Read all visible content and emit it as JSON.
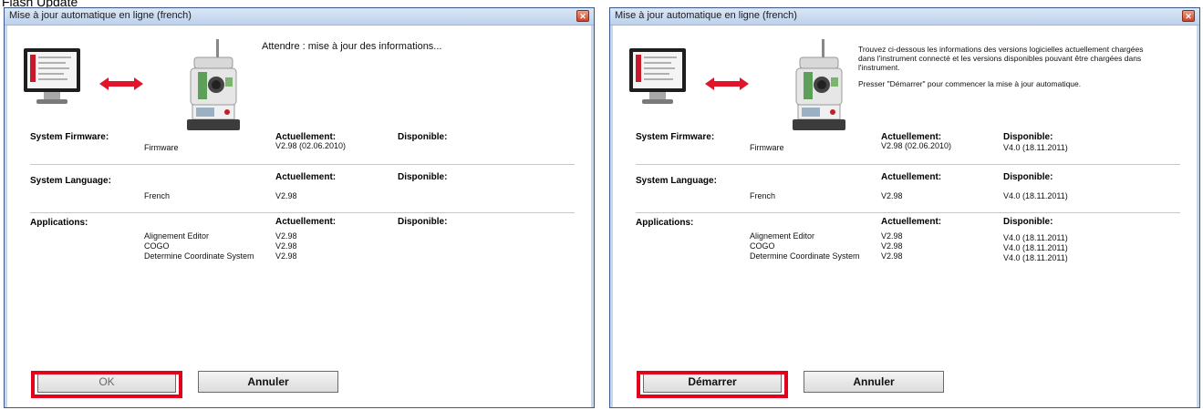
{
  "caption": "Flash Update",
  "windows": [
    {
      "title": "Mise à jour automatique en ligne (french)",
      "status": "Attendre : mise à jour des informations...",
      "info": [],
      "firmware": {
        "label": "System Firmware:",
        "current_head": "Actuellement:",
        "avail_head": "Disponible:",
        "items": [
          {
            "name": "Firmware",
            "current": "V2.98 (02.06.2010)",
            "avail": ""
          }
        ]
      },
      "language": {
        "label": "System Language:",
        "current_head": "Actuellement:",
        "avail_head": "Disponible:",
        "items": [
          {
            "name": "French",
            "current": "V2.98",
            "avail": ""
          }
        ]
      },
      "applications": {
        "label": "Applications:",
        "current_head": "Actuellement:",
        "avail_head": "Disponible:",
        "items": [
          {
            "name": "Alignement Editor",
            "current": "V2.98",
            "avail": ""
          },
          {
            "name": "COGO",
            "current": "V2.98",
            "avail": ""
          },
          {
            "name": "Determine Coordinate System",
            "current": "V2.98",
            "avail": ""
          }
        ]
      },
      "primary_button": "OK",
      "secondary_button": "Annuler",
      "primary_disabled": true
    },
    {
      "title": "Mise à jour automatique en ligne (french)",
      "status": "",
      "info": [
        "Trouvez ci-dessous les informations des versions logicielles actuellement chargées dans l'instrument connecté et les versions disponibles pouvant être chargées dans l'instrument.",
        "Presser \"Démarrer\" pour commencer la mise à jour automatique."
      ],
      "firmware": {
        "label": "System Firmware:",
        "current_head": "Actuellement:",
        "avail_head": "Disponible:",
        "items": [
          {
            "name": "Firmware",
            "current": "V2.98 (02.06.2010)",
            "avail": "V4.0 (18.11.2011)"
          }
        ]
      },
      "language": {
        "label": "System Language:",
        "current_head": "Actuellement:",
        "avail_head": "Disponible:",
        "items": [
          {
            "name": "French",
            "current": "V2.98",
            "avail": "V4.0 (18.11.2011)"
          }
        ]
      },
      "applications": {
        "label": "Applications:",
        "current_head": "Actuellement:",
        "avail_head": "Disponible:",
        "items": [
          {
            "name": "Alignement Editor",
            "current": "V2.98",
            "avail": "V4.0 (18.11.2011)"
          },
          {
            "name": "COGO",
            "current": "V2.98",
            "avail": "V4.0 (18.11.2011)"
          },
          {
            "name": "Determine Coordinate System",
            "current": "V2.98",
            "avail": "V4.0 (18.11.2011)"
          }
        ]
      },
      "primary_button": "Démarrer",
      "secondary_button": "Annuler",
      "primary_disabled": false
    }
  ],
  "colors": {
    "highlight": "#e3001b",
    "titlebar": "#bcd1ec"
  },
  "icons": [
    "computer-monitor-icon",
    "double-arrow-icon",
    "total-station-icon",
    "close-icon"
  ]
}
